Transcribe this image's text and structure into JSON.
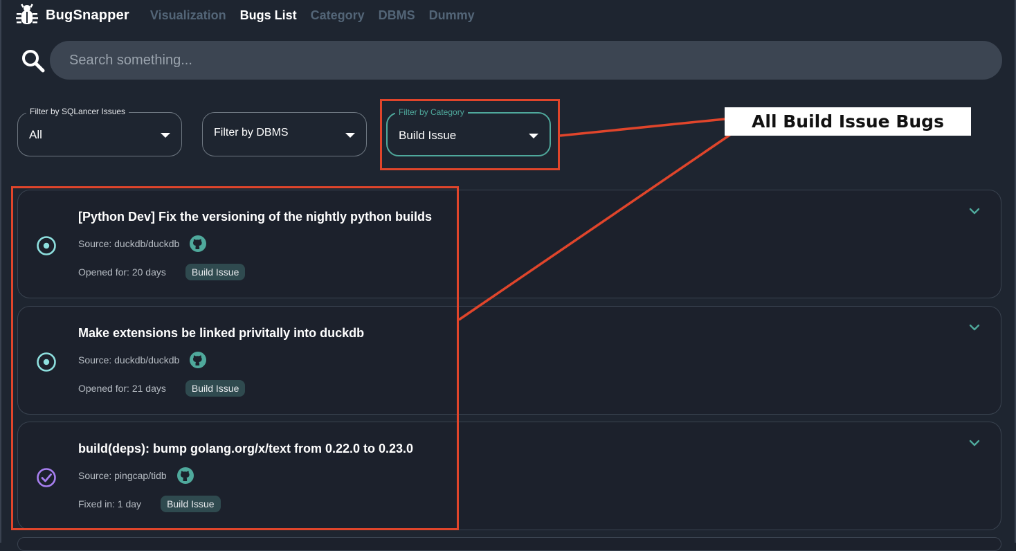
{
  "app": {
    "brand": "BugSnapper",
    "nav": [
      {
        "label": "Visualization",
        "active": false
      },
      {
        "label": "Bugs List",
        "active": true
      },
      {
        "label": "Category",
        "active": false
      },
      {
        "label": "DBMS",
        "active": false
      },
      {
        "label": "Dummy",
        "active": false
      }
    ]
  },
  "search": {
    "placeholder": "Search something..."
  },
  "filters": [
    {
      "legend": "Filter by SQLancer Issues",
      "value": "All"
    },
    {
      "legend": "",
      "value": "Filter by DBMS"
    },
    {
      "legend": "Filter by Category",
      "value": "Build Issue"
    }
  ],
  "annotation": {
    "label": "All Build Issue Bugs",
    "color": "#e0452b"
  },
  "bugs": [
    {
      "title": "[Python Dev] Fix the versioning of the nightly python builds",
      "source": "Source: duckdb/duckdb",
      "meta": "Opened for: 20 days",
      "badge": "Build Issue",
      "status_icon": "open-circle-icon",
      "status_color": "#8ee0df"
    },
    {
      "title": "Make extensions be linked privitally into duckdb",
      "source": "Source: duckdb/duckdb",
      "meta": "Opened for: 21 days",
      "badge": "Build Issue",
      "status_icon": "open-circle-icon",
      "status_color": "#8ee0df"
    },
    {
      "title": "build(deps): bump golang.org/x/text from 0.22.0 to 0.23.0",
      "source": "Source: pingcap/tidb",
      "meta": "Fixed in: 1 day",
      "badge": "Build Issue",
      "status_icon": "fixed-check-icon",
      "status_color": "#a77ff0"
    }
  ],
  "colors": {
    "accent": "#4fa99c",
    "background": "#1e2530",
    "card": "#1c212c"
  }
}
